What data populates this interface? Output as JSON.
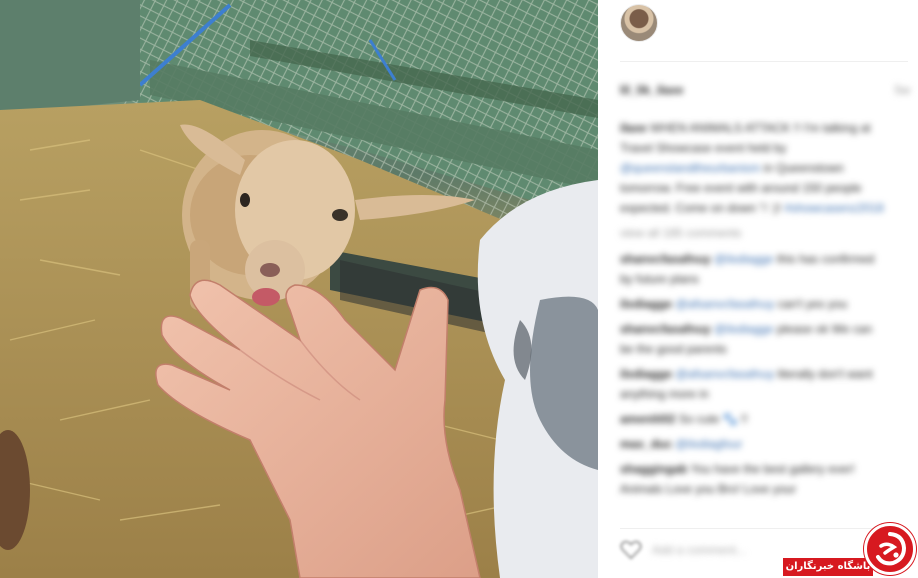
{
  "photo": {
    "subject": "goat-and-hand-photo"
  },
  "post": {
    "username": "lil_lik_ilaxe",
    "time": "5w"
  },
  "caption": {
    "user": "ilaxe",
    "text": "WHEN ANIMALS ATTACK !! I'm talking at Travel Showcase event held by",
    "mention": "@queenslandtheurbanism",
    "text2": "in Queenstown tomorrow. Free event with around 150 people expected. Come on down \"/ :)!",
    "hashtag": "#showcasenz2018"
  },
  "view_all": "view all 185 comments",
  "comments": [
    {
      "user": "shanvcfasafnuy",
      "mention": "@ilxdiagge",
      "text": "this has confirmed by future plans"
    },
    {
      "user": "ilxdiagge",
      "mention": "@afsanvcfasafnuy",
      "text": "can't yes you"
    },
    {
      "user": "shanvcfasafnuy",
      "mention": "@ilxdiagge",
      "text": "please ok We can be the good parents"
    },
    {
      "user": "ilxdiagge",
      "mention": "@afsanvcfasafnuy",
      "text": "literally don't want anything more in"
    },
    {
      "user": "ameniti02",
      "mention": "",
      "text": "So cute 🐾 !!"
    },
    {
      "user": "max_duc",
      "mention": "@ilxdiagfour",
      "text": ""
    },
    {
      "user": "shaggingab",
      "mention": "",
      "text": "You have the best gallery ever! Animals Love you Bro! Love your"
    }
  ],
  "add_comment": {
    "placeholder": "Add a comment..."
  },
  "watermark": {
    "label": "باشگاه خبرنگاران"
  },
  "colors": {
    "link": "#3a6fb0",
    "watermark_red": "#d71920"
  }
}
